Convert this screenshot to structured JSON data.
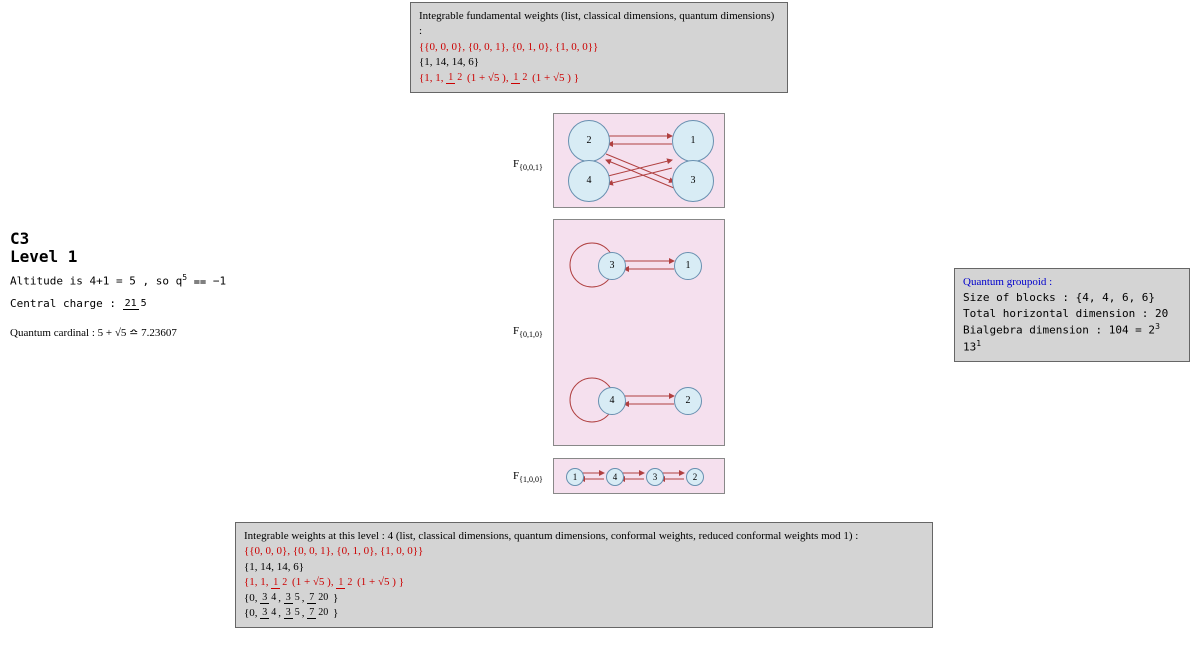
{
  "topBox": {
    "title": "Integrable fundamental weights (list, classical dimensions, quantum dimensions) :",
    "weightsList": "{{0, 0, 0}, {0, 0, 1}, {0, 1, 0}, {1, 0, 0}}",
    "classicalDims": "{1, 14, 14, 6}",
    "quantumDimsPrefix": "{1, 1, ",
    "quantumDimsHalf": "1",
    "quantumDimsHalfD": "2",
    "quantumDimsExpr": "(1 + √5 )",
    "quantumDimsSuffix": "}"
  },
  "titleBlock": {
    "line1": "C3",
    "line2": "Level 1",
    "altitude": "Altitude is 4+1 = 5 , so q",
    "altitudeExp": "5",
    "altitudeEq": " ⩵ −1",
    "centralChargeLabel": "Central charge : ",
    "ccNum": "21",
    "ccDen": "5",
    "quantumCardinal": "Quantum cardinal : 5 + √5   ≏  7.23607"
  },
  "graphs": {
    "g1": {
      "label": "F",
      "sub": "{0,0,1}",
      "nodes": [
        "2",
        "1",
        "4",
        "3"
      ]
    },
    "g2": {
      "label": "F",
      "sub": "{0,1,0}",
      "nodes": [
        "3",
        "1",
        "4",
        "2"
      ]
    },
    "g3": {
      "label": "F",
      "sub": "{1,0,0}",
      "nodes": [
        "1",
        "4",
        "3",
        "2"
      ]
    }
  },
  "qg": {
    "title": "Quantum groupoid :",
    "line1": "Size of blocks : {4, 4, 6, 6}",
    "line2": "Total horizontal dimension : 20",
    "line3pre": "Bialgebra dimension : 104  =  2",
    "line3e1": "3",
    "line3mid": " 13",
    "line3e2": "1"
  },
  "bottomBox": {
    "title": "Integrable weights at this level :  4 (list, classical dimensions, quantum dimensions, conformal weights, reduced conformal weights mod 1) :",
    "weightsList": "{{0, 0, 0}, {0, 0, 1}, {0, 1, 0}, {1, 0, 0}}",
    "classicalDims": "{1, 14, 14, 6}",
    "qPrefix": "{1, 1, ",
    "half": "1",
    "halfD": "2",
    "qExpr": "(1 + √5 )",
    "qSuffix": "}",
    "cwPrefix": "{0, ",
    "cw1n": "3",
    "cw1d": "4",
    "cw2n": "3",
    "cw2d": "5",
    "cw3n": "7",
    "cw3d": "20",
    "cwSuffix": "}"
  }
}
